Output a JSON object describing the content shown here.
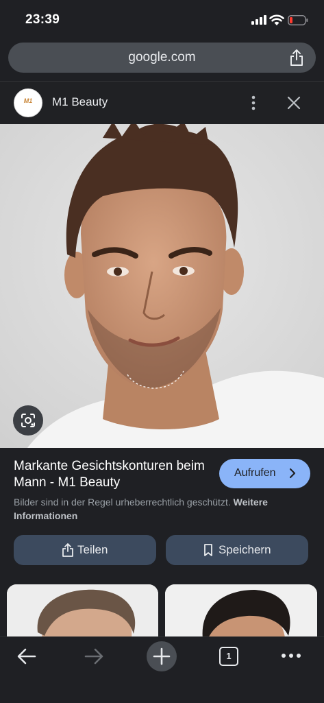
{
  "status_bar": {
    "time": "23:39"
  },
  "url_bar": {
    "url": "google.com"
  },
  "site_header": {
    "site_name": "M1 Beauty",
    "logo_text": "M1"
  },
  "result": {
    "title": "Markante Gesichtskonturen beim Mann - M1 Beauty",
    "visit_label": "Aufrufen",
    "copyright_text": "Bilder sind in der Regel urheberrechtlich geschützt.",
    "more_info_label": "Weitere Informationen",
    "share_label": "Teilen",
    "save_label": "Speichern"
  },
  "toolbar": {
    "tab_count": "1"
  },
  "colors": {
    "accent": "#8ab4f8",
    "button_bg": "#3c4a5e",
    "background": "#1f2024"
  },
  "icons": [
    "signal-icon",
    "wifi-icon",
    "battery-icon",
    "share-icon",
    "kebab-icon",
    "close-icon",
    "lens-icon",
    "chevron-right-icon",
    "bookmark-icon",
    "back-arrow-icon",
    "forward-arrow-icon",
    "new-tab-icon",
    "tabs-icon",
    "more-icon"
  ]
}
